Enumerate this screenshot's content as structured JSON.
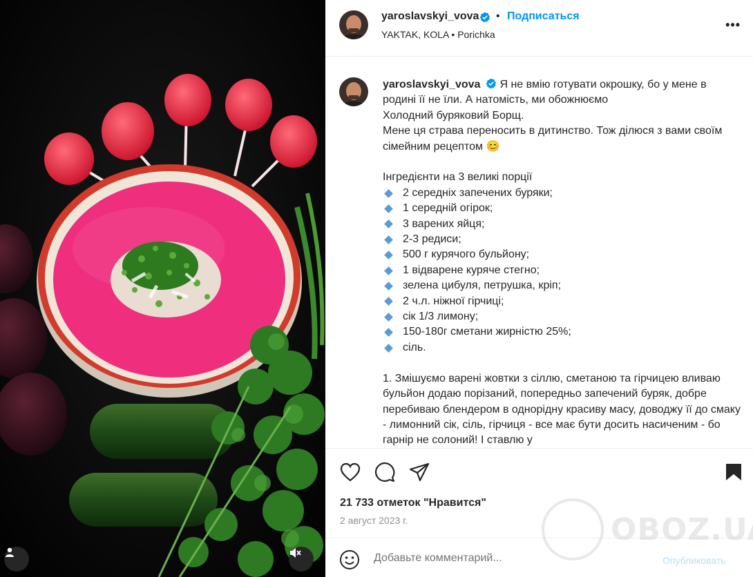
{
  "post": {
    "username": "yaroslavskyi_vova",
    "follow_label": "Подписаться",
    "dot": "•",
    "audio": "YAKTAK, KOLA • Porichka",
    "more_label": "•••"
  },
  "caption": {
    "username": "yaroslavskyi_vova",
    "intro": "Я не вмію готувати окрошку, бо у мене в родині її не їли. А натомість, ми обожнюємо",
    "line2": "Холодний буряковий Борщ.",
    "line3": "Мене ця страва переносить в дитинство. Тож ділюся з вами своїм сімейним рецептом 😊",
    "ingredients_title": "Інгредієнти на 3 великі порції",
    "ingredients": [
      "2 середніх запечених буряки;",
      "1 середній огірок;",
      "3 варених яйця;",
      "2-3 редиси;",
      "500 г курячого бульйону;",
      "1 відварене куряче стегно;",
      "зелена цибуля, петрушка, кріп;",
      "2 ч.л. ніжної гірчиці;",
      "сік 1/3 лимону;",
      "150-180г сметани жирністю 25%;",
      "сіль."
    ],
    "step1": "1. Змішуємо варені жовтки з сіллю, сметаною та гірчицею вливаю бульйон додаю порізаний, попередньо запечений буряк, добре перебиваю блендером в однорідну красиву масу, доводжу її до смаку - лимонний сік, сіль, гірчиця - все має бути досить насиченим - бо гарнір не солоний! І ставлю у"
  },
  "stats": {
    "likes": "21 733 отметок \"Нравится\"",
    "date": "2 август 2023 г."
  },
  "comment": {
    "placeholder": "Добавьте комментарий...",
    "publish_label": "Опубликовать"
  },
  "watermark": "OBOZ.UA",
  "colors": {
    "accent": "#0095f6",
    "verified": "#0095f6",
    "soup": "#ef2f7d",
    "bowl_rim": "#d23a2c"
  }
}
